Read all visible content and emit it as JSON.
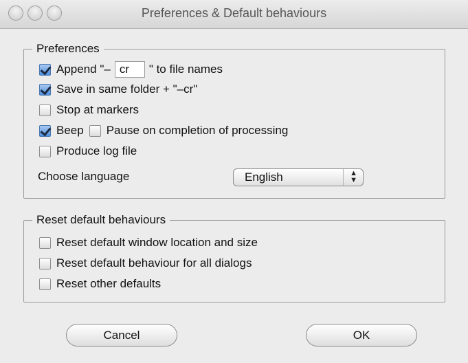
{
  "window": {
    "title": "Preferences & Default behaviours"
  },
  "preferences": {
    "label": "Preferences",
    "append_prefix": "Append \"–",
    "append_value": "cr",
    "append_suffix": "\" to file names",
    "save_same_folder": "Save in same folder + \"–cr\"",
    "stop_at_markers": "Stop at markers",
    "beep": "Beep",
    "pause_on_completion": "Pause on completion of processing",
    "produce_log_file": "Produce log file",
    "choose_language_label": "Choose language",
    "language_selected": "English",
    "checked": {
      "append": true,
      "save_same_folder": true,
      "stop_at_markers": false,
      "beep": true,
      "pause_on_completion": false,
      "produce_log_file": false
    }
  },
  "reset": {
    "label": "Reset default behaviours",
    "window_location": "Reset default window location and size",
    "behaviour_dialogs": "Reset default behaviour for all dialogs",
    "other_defaults": "Reset other defaults"
  },
  "buttons": {
    "cancel": "Cancel",
    "ok": "OK"
  },
  "icons": {
    "close": "close-icon",
    "minimize": "minimize-icon",
    "zoom": "zoom-icon",
    "select_arrows": "updown-arrows-icon"
  }
}
